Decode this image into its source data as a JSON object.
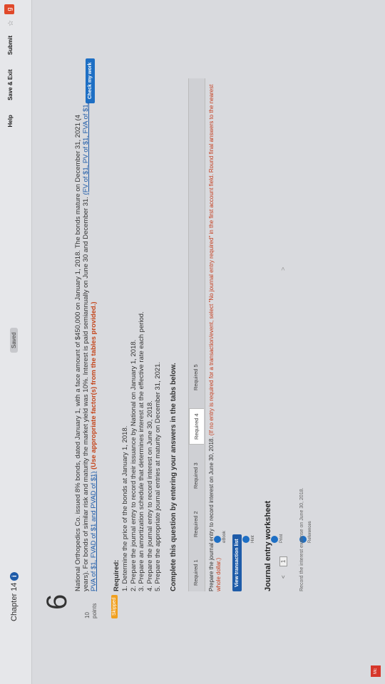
{
  "header": {
    "chapter": "Chapter 14",
    "saved": "Saved",
    "help": "Help",
    "save_exit": "Save & Exit",
    "submit": "Submit"
  },
  "question": {
    "number": "6",
    "points_value": "10",
    "points_label": "points",
    "skipped": "Skipped",
    "check_button": "Check my work"
  },
  "sidebar_tools": [
    "Hint",
    "Print",
    "References",
    "eBook"
  ],
  "problem": {
    "text": "National Orthopedics Co. issued 8% bonds, dated January 1, with a face amount of $450,000 on January 1, 2018. The bonds mature on December 31, 2021 (4 years). For bonds of similar risk and maturity the market yield was 10%. Interest is paid semiannually on June 30 and December 31.",
    "links": "(FV of $1, PV of $1, FVA of $1, PVA of $1, FVAD of $1 and PVAD of $1)",
    "instruction": "(Use appropriate factor(s) from the tables provided.)"
  },
  "required": {
    "heading": "Required:",
    "items": [
      "1. Determine the price of the bonds at January 1, 2018.",
      "2. Prepare the journal entry to record their issuance by National on January 1, 2018.",
      "3. Prepare an amortization schedule that determines interest at the effective rate each period.",
      "4. Prepare the journal entry to record interest on June 30, 2018.",
      "5. Prepare the appropriate journal entries at maturity on December 31, 2021."
    ]
  },
  "complete_label": "Complete this question by entering your answers in the tabs below.",
  "tabs": [
    "Required 1",
    "Required 2",
    "Required 3",
    "Required 4",
    "Required 5"
  ],
  "tab_instruction": "Prepare the journal entry to record interest on June 30, 2018.",
  "tab_note": "(If no entry is required for a transaction/event, select \"No journal entry required\" in the first account field. Round final answers to the nearest whole dollar.)",
  "view_transaction_list": "View transaction list",
  "worksheet": {
    "title": "Journal entry worksheet",
    "prev": "<",
    "page": "1",
    "next": ">",
    "record_text": "Record the interest expense on June 30, 2018."
  }
}
